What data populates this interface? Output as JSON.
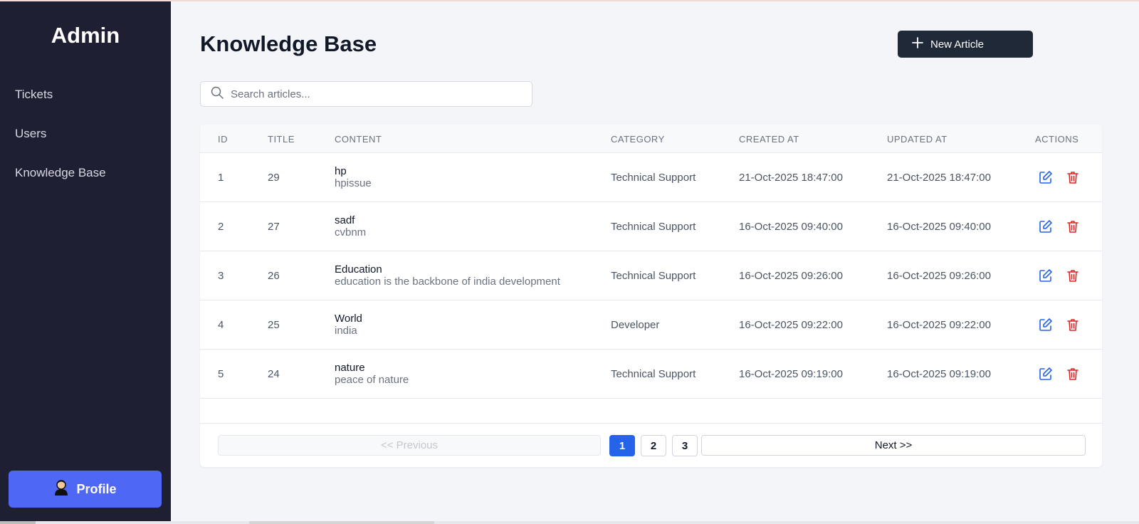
{
  "sidebar": {
    "brand": "Admin",
    "items": [
      {
        "label": "Tickets"
      },
      {
        "label": "Users"
      },
      {
        "label": "Knowledge Base"
      }
    ],
    "profile_label": "Profile"
  },
  "header": {
    "title": "Knowledge Base",
    "new_button_label": "New Article"
  },
  "search": {
    "placeholder": "Search articles...",
    "value": ""
  },
  "table": {
    "columns": [
      "ID",
      "TITLE",
      "CONTENT",
      "CATEGORY",
      "CREATED AT",
      "UPDATED AT",
      "ACTIONS"
    ],
    "rows": [
      {
        "id": "1",
        "title": "29",
        "content_title": "hp",
        "content_body": "hpissue",
        "category": "Technical Support",
        "created": "21-Oct-2025 18:47:00",
        "updated": "21-Oct-2025 18:47:00"
      },
      {
        "id": "2",
        "title": "27",
        "content_title": "sadf",
        "content_body": "cvbnm",
        "category": "Technical Support",
        "created": "16-Oct-2025 09:40:00",
        "updated": "16-Oct-2025 09:40:00"
      },
      {
        "id": "3",
        "title": "26",
        "content_title": "Education",
        "content_body": "education is the backbone of india development",
        "category": "Technical Support",
        "created": "16-Oct-2025 09:26:00",
        "updated": "16-Oct-2025 09:26:00"
      },
      {
        "id": "4",
        "title": "25",
        "content_title": "World",
        "content_body": "india",
        "category": "Developer",
        "created": "16-Oct-2025 09:22:00",
        "updated": "16-Oct-2025 09:22:00"
      },
      {
        "id": "5",
        "title": "24",
        "content_title": "nature",
        "content_body": "peace of nature",
        "category": "Technical Support",
        "created": "16-Oct-2025 09:19:00",
        "updated": "16-Oct-2025 09:19:00"
      }
    ]
  },
  "pagination": {
    "prev_label": "<< Previous",
    "next_label": "Next >>",
    "pages": [
      "1",
      "2",
      "3"
    ],
    "current": "1"
  },
  "icons": {
    "edit": "edit-icon",
    "delete": "trash-icon",
    "search": "search-icon",
    "plus": "plus-icon",
    "profile": "user-avatar-icon"
  },
  "colors": {
    "sidebar_bg": "#1f1f33",
    "accent": "#4f67f5",
    "primary_dark": "#1f2937",
    "edit": "#2563eb",
    "delete": "#dc2626",
    "page_active": "#2563eb"
  }
}
